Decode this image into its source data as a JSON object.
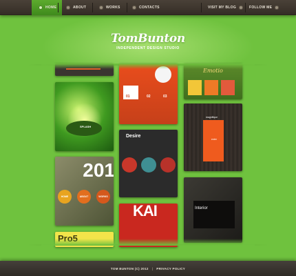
{
  "nav": {
    "home": "Home",
    "about": "About",
    "works": "Works",
    "contacts": "Contacts",
    "blog": "Visit my blog",
    "follow": "Follow me"
  },
  "header": {
    "logo": "TomBunton",
    "tagline": "Independent design studio"
  },
  "gallery": {
    "green_label": "SPLASH",
    "leaf_big": "201",
    "leaf_circles": [
      "HOME",
      "ABOUT",
      "WORKS"
    ],
    "pro_text": "Pro5",
    "orange_numbers": [
      "01",
      "02",
      "03"
    ],
    "desire_title": "Desire",
    "red_word": "KAI",
    "emotion_title": "Emotio",
    "wood_brand": "magnifique",
    "wood_enter": "enter",
    "interior_label": "Interior"
  },
  "footer": {
    "copyright": "TOM BUNTON (C) 2012",
    "separator": "|",
    "privacy": "PRIVACY POLICY"
  },
  "colors": {
    "background": "#6fc23e",
    "accent_green": "#4a9a24",
    "bar_dark": "#3a342e",
    "orange": "#e94d1c"
  }
}
